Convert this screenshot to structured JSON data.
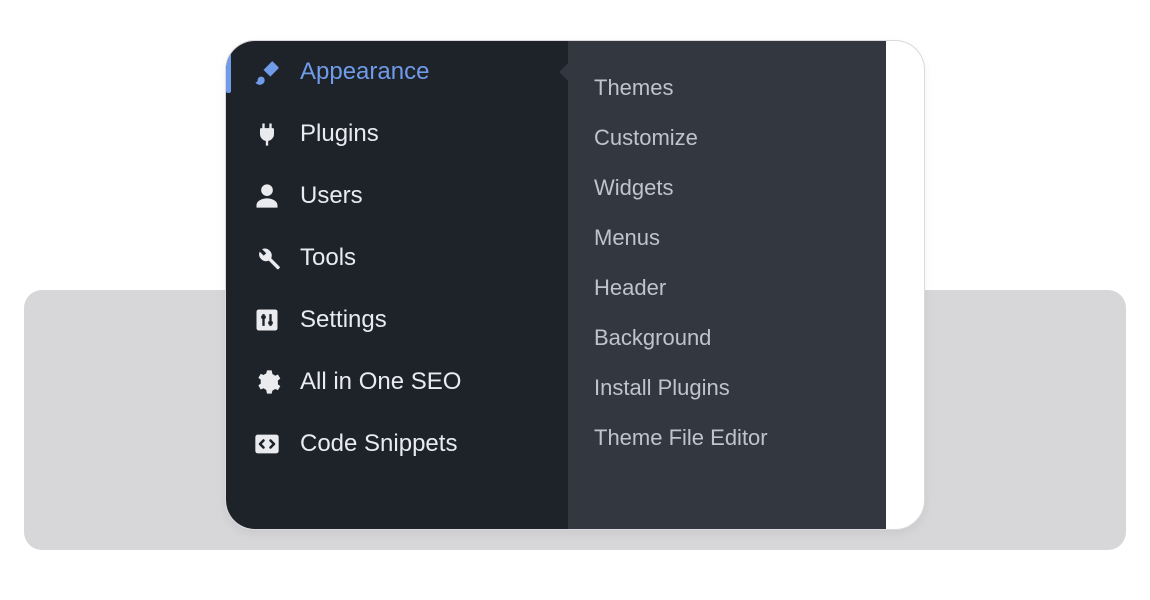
{
  "sidebar": {
    "items": [
      {
        "label": "Appearance",
        "icon": "brush-icon",
        "active": true
      },
      {
        "label": "Plugins",
        "icon": "plug-icon",
        "active": false
      },
      {
        "label": "Users",
        "icon": "user-icon",
        "active": false
      },
      {
        "label": "Tools",
        "icon": "wrench-icon",
        "active": false
      },
      {
        "label": "Settings",
        "icon": "sliders-icon",
        "active": false
      },
      {
        "label": "All in One SEO",
        "icon": "gear-icon",
        "active": false
      },
      {
        "label": "Code Snippets",
        "icon": "code-icon",
        "active": false
      }
    ]
  },
  "flyout": {
    "items": [
      "Themes",
      "Customize",
      "Widgets",
      "Menus",
      "Header",
      "Background",
      "Install Plugins",
      "Theme File Editor"
    ]
  },
  "colors": {
    "accent": "#6f9be8",
    "sidebar_bg": "#1e2229",
    "flyout_bg": "#33373f"
  }
}
